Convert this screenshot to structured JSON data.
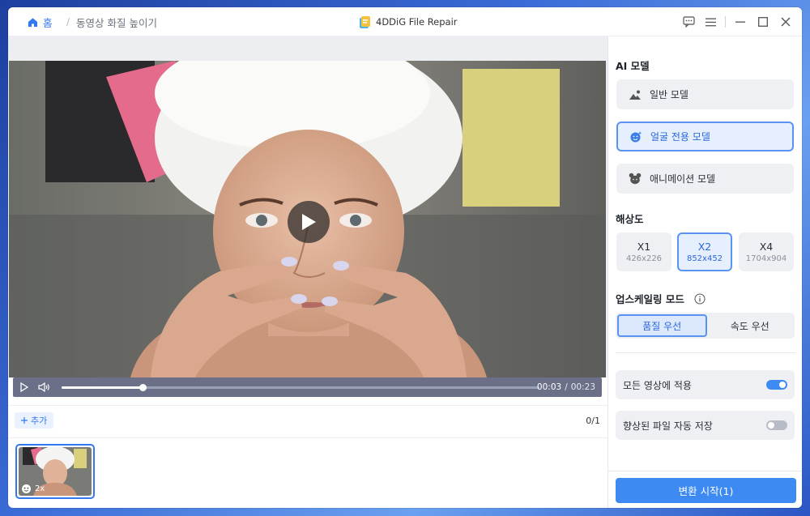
{
  "breadcrumb": {
    "home": "홈",
    "separator": "/",
    "current": "동영상 화질 높이기"
  },
  "app": {
    "title": "4DDiG File Repair"
  },
  "window_controls": [
    "feedback-icon",
    "menu-icon",
    "minimize-icon",
    "maximize-icon",
    "close-icon"
  ],
  "player": {
    "current_time": "00:03",
    "separator": "/",
    "total_time": "00:23",
    "progress": 0.17
  },
  "list": {
    "add_label": "추가",
    "count": "0/1",
    "thumb_badge": "2x"
  },
  "panel": {
    "ai_model_title": "AI 모델",
    "models": [
      {
        "label": "일반 모델",
        "icon": "landscape-icon",
        "selected": false
      },
      {
        "label": "얼굴 전용 모델",
        "icon": "face-icon",
        "selected": true
      },
      {
        "label": "애니메이션 모델",
        "icon": "anime-icon",
        "selected": false
      }
    ],
    "resolution_title": "해상도",
    "resolutions": [
      {
        "label": "X1",
        "size": "426x226",
        "selected": false
      },
      {
        "label": "X2",
        "size": "852x452",
        "selected": true
      },
      {
        "label": "X4",
        "size": "1704x904",
        "selected": false
      }
    ],
    "upscale_title": "업스케일링 모드",
    "modes": [
      {
        "label": "품질 우선",
        "selected": true
      },
      {
        "label": "속도 우선",
        "selected": false
      }
    ],
    "apply_all": {
      "label": "모든 영상에 적용",
      "on": true
    },
    "auto_save": {
      "label": "향상된 파일 자동 저장",
      "on": false
    },
    "start_label": "변환 시작(1)"
  },
  "colors": {
    "accent": "#3478f0",
    "button": "#3d8bf2",
    "toggle_on": "#3d8bf2",
    "toggle_off": "#b8bcc6"
  }
}
